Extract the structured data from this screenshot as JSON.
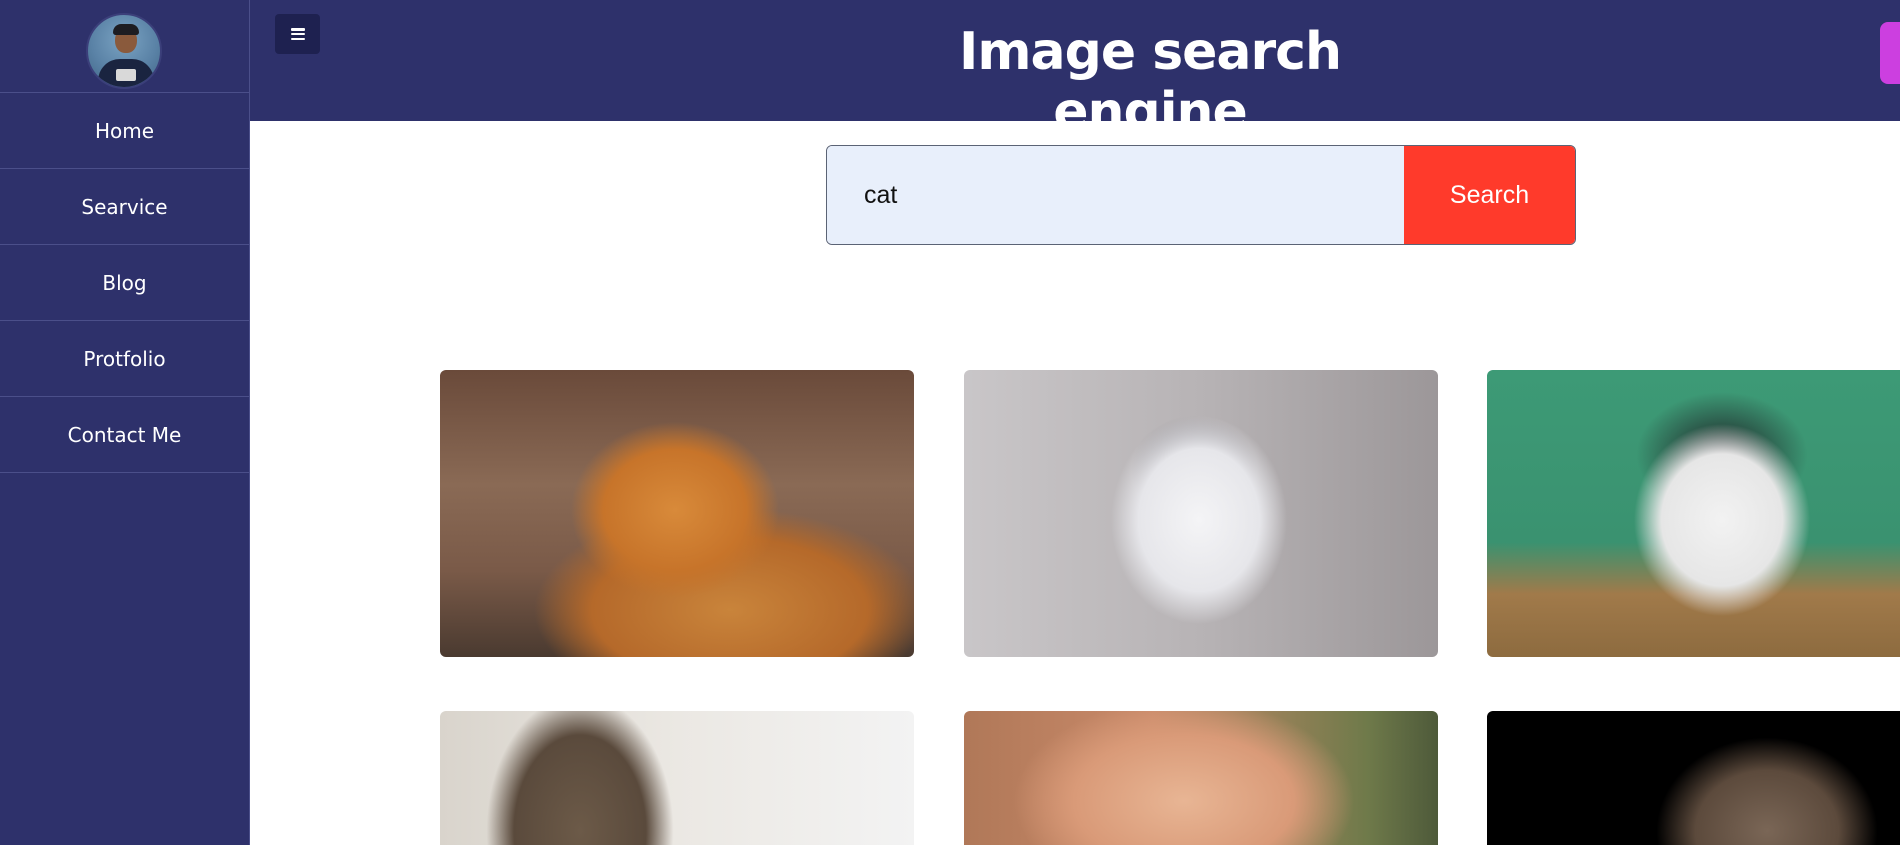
{
  "sidebar": {
    "items": [
      {
        "label": "Home"
      },
      {
        "label": "Searvice"
      },
      {
        "label": "Blog"
      },
      {
        "label": "Protfolio"
      },
      {
        "label": "Contact Me"
      }
    ]
  },
  "header": {
    "title": "Image search engine",
    "menu_icon": "hamburger-menu-icon"
  },
  "search": {
    "value": "cat",
    "button_label": "Search"
  },
  "colors": {
    "sidebar_bg": "#2e316b",
    "header_bg": "#2e316b",
    "search_button": "#ff3a2b",
    "input_bg": "#e8effb",
    "accent": "#cc3fe0"
  },
  "results": [
    {
      "subject": "orange tabby cat"
    },
    {
      "subject": "white siamese cat"
    },
    {
      "subject": "black and white cat"
    },
    {
      "subject": "tabby cat sitting"
    },
    {
      "subject": "ginger cat lying"
    },
    {
      "subject": "tabby cat on black"
    }
  ]
}
